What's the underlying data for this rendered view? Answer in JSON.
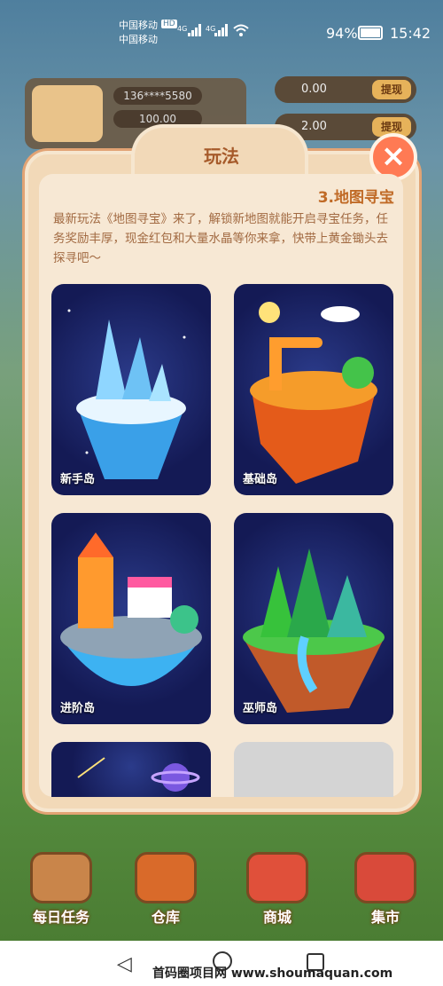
{
  "status_bar": {
    "carrier_top": "中国移动",
    "carrier_bottom": "中国移动",
    "hd_badge": "HD",
    "network": "4G",
    "battery": "94%",
    "time": "15:42"
  },
  "header": {
    "phone": "136****5580",
    "coin_value": "100.00",
    "cash1": "0.00",
    "cash2": "2.00",
    "withdraw_label": "提现"
  },
  "modal": {
    "title": "玩法",
    "section_title": "3.地图寻宝",
    "description": "最新玩法《地图寻宝》来了，解锁新地图就能开启寻宝任务，任务奖励丰厚，现金红包和大量水晶等你来拿，快带上黄金锄头去探寻吧～",
    "islands": [
      {
        "label": "新手岛",
        "icon": "ice-island"
      },
      {
        "label": "基础岛",
        "icon": "desert-island"
      },
      {
        "label": "进阶岛",
        "icon": "shop-island"
      },
      {
        "label": "巫师岛",
        "icon": "forest-island"
      }
    ]
  },
  "dock": {
    "items": [
      {
        "label": "每日任务",
        "icon": "task-book-icon"
      },
      {
        "label": "仓库",
        "icon": "barn-icon"
      },
      {
        "label": "商城",
        "icon": "shop-icon"
      },
      {
        "label": "集市",
        "icon": "market-icon"
      }
    ]
  },
  "watermark": "首码圈项目网 www.shoumaquan.com",
  "colors": {
    "modal_bg": "#f2d9b8",
    "title": "#a65a2a",
    "accent": "#ff7a54"
  }
}
